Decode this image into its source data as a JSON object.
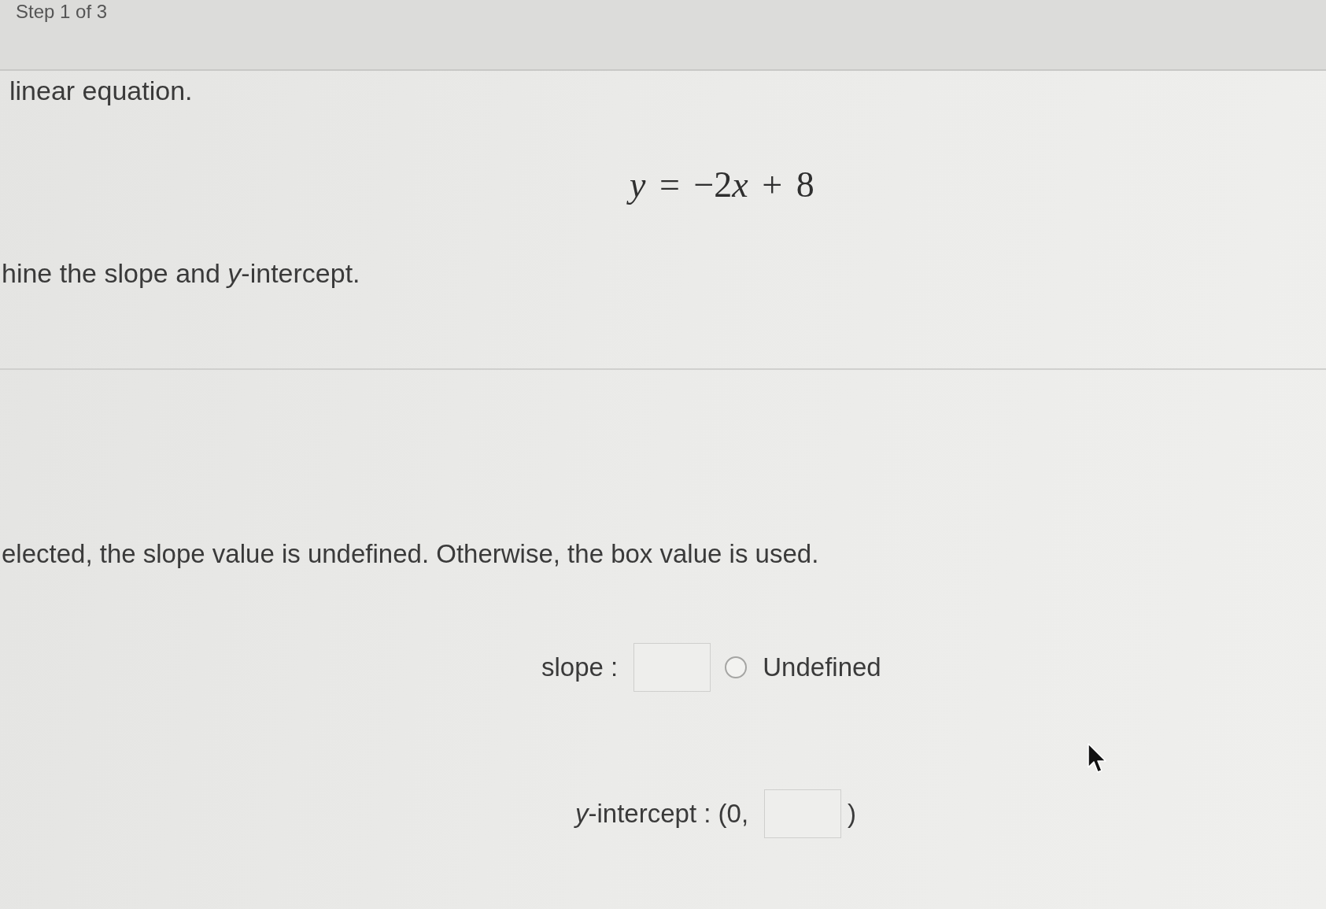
{
  "header": {
    "step_label": "Step 1 of 3"
  },
  "prompt": {
    "intro": "linear equation.",
    "equation": [
      {
        "kind": "variable",
        "text": "y"
      },
      {
        "kind": "operator",
        "text": "="
      },
      {
        "kind": "number",
        "text": "−2"
      },
      {
        "kind": "variable",
        "text": "x"
      },
      {
        "kind": "operator",
        "text": "+"
      },
      {
        "kind": "number",
        "text": "8"
      }
    ],
    "instruction": "hine the slope and *y*-intercept."
  },
  "question": {
    "note": "elected, the slope value is undefined. Otherwise, the box value is used.",
    "slope": {
      "label": "slope :",
      "options": [
        {
          "label": "Undefined",
          "selected": false
        }
      ]
    },
    "y_intercept": {
      "label": "*y*-intercept : (0,",
      "closing": ")"
    }
  }
}
